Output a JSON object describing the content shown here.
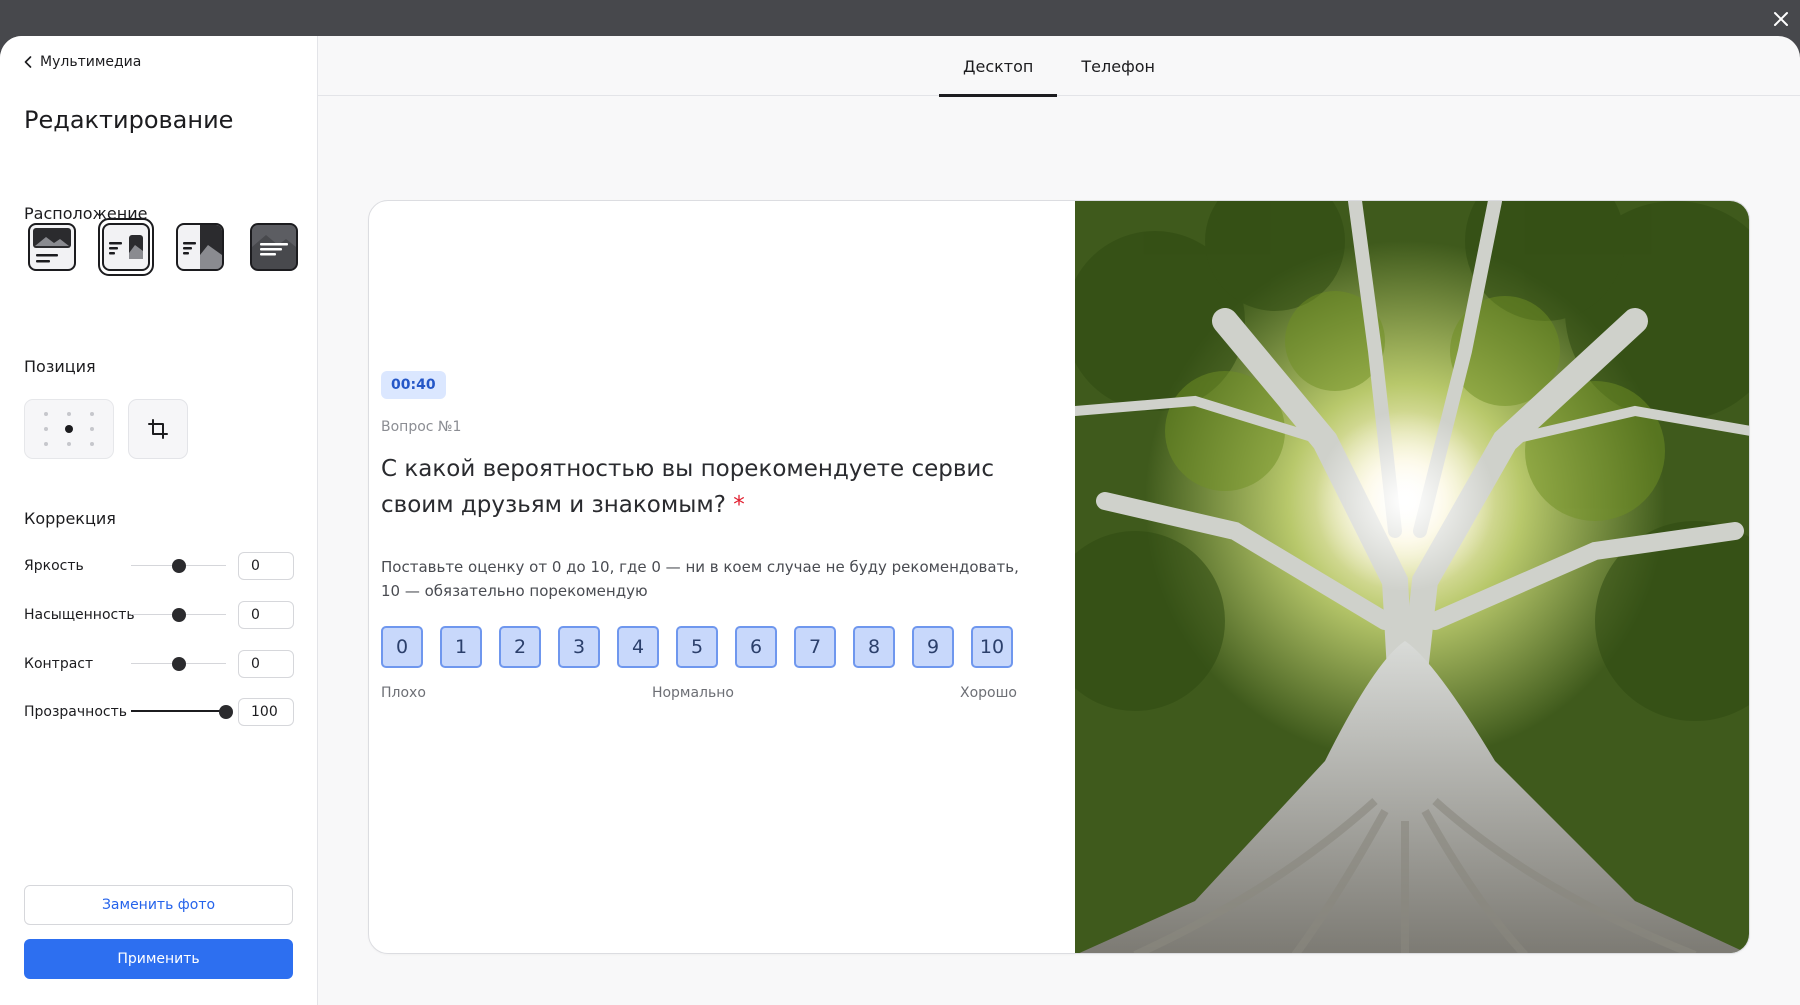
{
  "header": {
    "close_icon": "close-icon"
  },
  "sidebar": {
    "back_label": "Мультимедиа",
    "title": "Редактирование",
    "layout_section": "Расположение",
    "layouts": [
      {
        "icon": "layout-image-top-icon",
        "selected": false
      },
      {
        "icon": "layout-image-right-icon",
        "selected": true
      },
      {
        "icon": "layout-split-icon",
        "selected": false
      },
      {
        "icon": "layout-background-icon",
        "selected": false
      }
    ],
    "position_section": "Позиция",
    "crop_icon": "crop-icon",
    "correction_section": "Коррекция",
    "sliders": [
      {
        "label": "Яркость",
        "value": "0",
        "fraction": 0.5
      },
      {
        "label": "Насыщенность",
        "value": "0",
        "fraction": 0.5
      },
      {
        "label": "Контраст",
        "value": "0",
        "fraction": 0.5
      },
      {
        "label": "Прозрачность",
        "value": "100",
        "fraction": 1.0
      }
    ],
    "replace_label": "Заменить фото",
    "apply_label": "Применить"
  },
  "tabs": [
    {
      "label": "Десктоп",
      "active": true
    },
    {
      "label": "Телефон",
      "active": false
    }
  ],
  "preview": {
    "timer": "00:40",
    "question_number": "Вопрос №1",
    "question_text": "С какой вероятностью вы порекомендуете сервис своим друзьям и знакомым?",
    "required_mark": "*",
    "description": "Поставьте оценку от 0 до 10, где 0 — ни в коем случае не буду рекомендовать, 10 — обязательно порекомендую",
    "scale": [
      "0",
      "1",
      "2",
      "3",
      "4",
      "5",
      "6",
      "7",
      "8",
      "9",
      "10"
    ],
    "scale_low": "Плохо",
    "scale_mid": "Нормально",
    "scale_high": "Хорошо"
  },
  "colors": {
    "accent": "#2d6ff0",
    "scale_fill": "#c8d8fb",
    "scale_border": "#6f97ee",
    "required": "#e11d2e"
  }
}
